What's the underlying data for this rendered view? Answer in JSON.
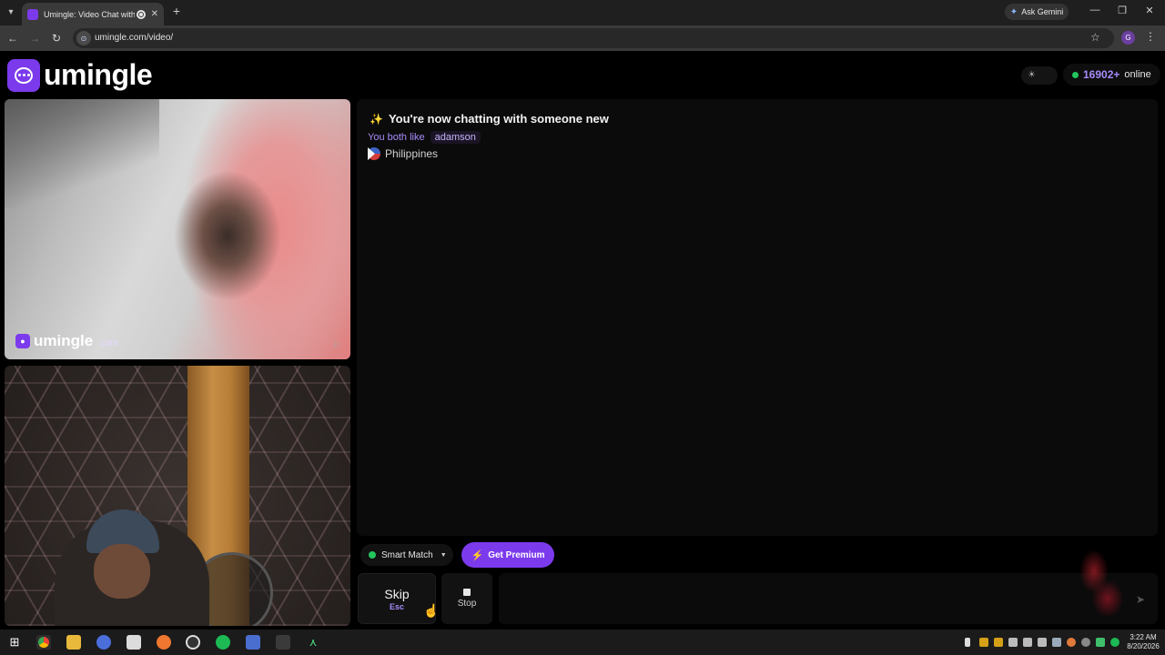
{
  "browser": {
    "tab_title": "Umingle: Video Chat with S",
    "new_tab": "+",
    "gemini_label": "Ask Gemini",
    "url": "umingle.com/video/",
    "profile_initial": "G"
  },
  "header": {
    "logo_text": "umingle",
    "online_count": "16902+",
    "online_label": "online"
  },
  "remote_video": {
    "watermark_text": "umingle",
    "watermark_suffix": ".com"
  },
  "chat": {
    "title": "You're now chatting with someone new",
    "interests_label": "You both like",
    "interest_tag": "adamson",
    "country": "Philippines"
  },
  "controls": {
    "smart_match_label": "Smart Match",
    "premium_label": "Get Premium",
    "skip_label": "Skip",
    "skip_hint": "Esc",
    "stop_label": "Stop",
    "message_placeholder": ""
  },
  "taskbar": {
    "time": "3:22 AM",
    "date": "8/20/2026"
  },
  "colors": {
    "brand": "#7c3aed",
    "online_dot": "#22c55e",
    "accent_text": "#a78bfa"
  },
  "icons": {
    "logo": "chat-bubble-icon",
    "theme": "sun-icon",
    "report": "flag-icon",
    "send": "send-icon"
  }
}
